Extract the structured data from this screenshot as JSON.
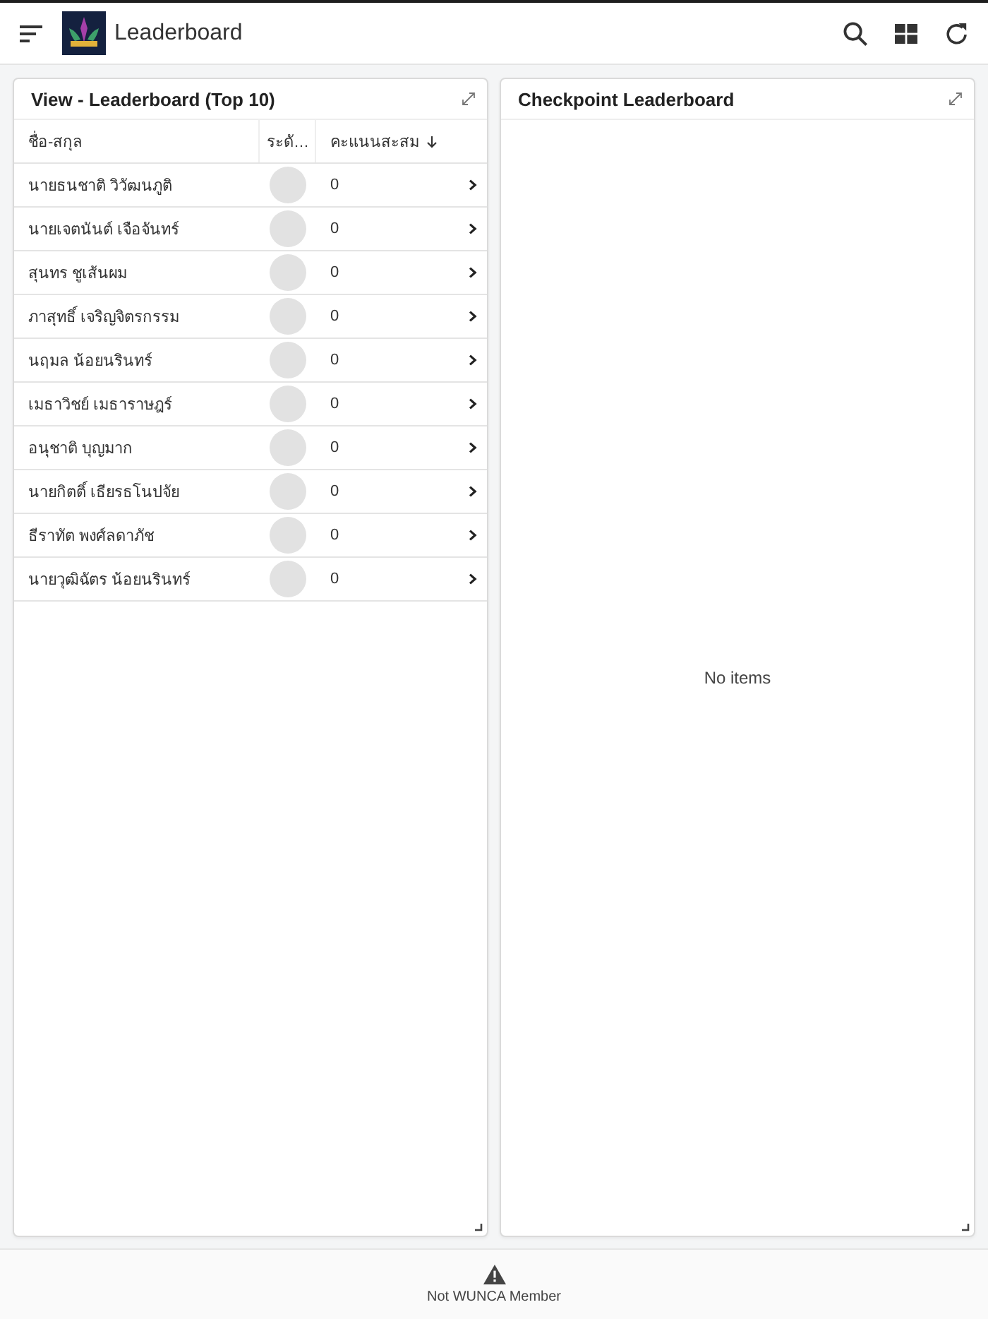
{
  "app_bar": {
    "title": "Leaderboard"
  },
  "panels": [
    {
      "kind": "table",
      "title": "View - Leaderboard (Top 10)",
      "columns": [
        {
          "label": "ชื่อ-สกุล",
          "sorted": false
        },
        {
          "label": "ระดั…",
          "sorted": false
        },
        {
          "label": "คะแนนสะสม",
          "sorted": true
        }
      ],
      "rows": [
        {
          "name": "นายธนชาติ วิวัฒนภูติ",
          "score": "0"
        },
        {
          "name": "นายเจตนันต์ เจือจันทร์",
          "score": "0"
        },
        {
          "name": "สุนทร ชูเส้นผม",
          "score": "0"
        },
        {
          "name": "ภาสุทธิ์ เจริญจิตรกรรม",
          "score": "0"
        },
        {
          "name": "นฤมล น้อยนรินทร์",
          "score": "0"
        },
        {
          "name": "เมธาวิชย์ เมธาราษฎร์",
          "score": "0"
        },
        {
          "name": "อนุชาติ บุญมาก",
          "score": "0"
        },
        {
          "name": "นายกิตติ์ เธียรธโนปจัย",
          "score": "0"
        },
        {
          "name": "ธีราทัต พงศ์ลดาภัช",
          "score": "0"
        },
        {
          "name": "นายวุฒิฉัตร น้อยนรินทร์",
          "score": "0"
        }
      ]
    },
    {
      "kind": "empty",
      "title": "Checkpoint Leaderboard",
      "empty_text": "No items"
    }
  ],
  "footer": {
    "text": "Not WUNCA Member"
  }
}
